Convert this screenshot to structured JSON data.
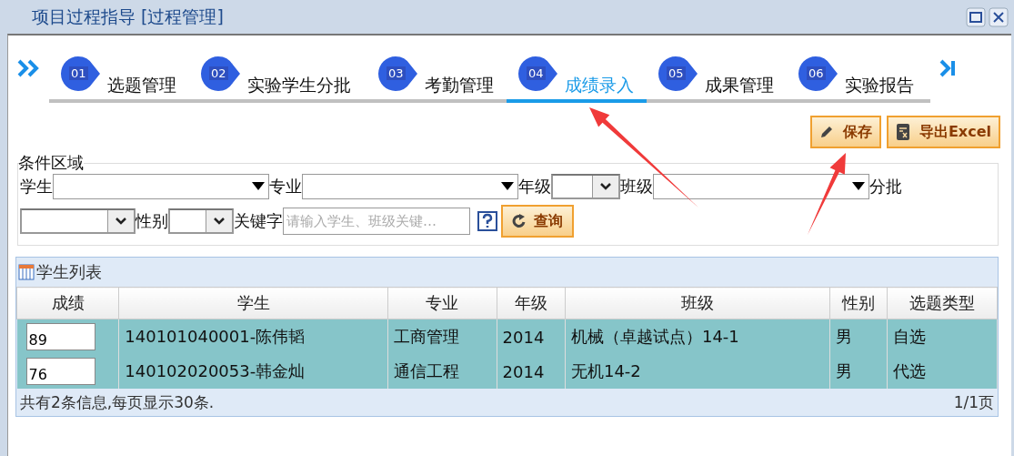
{
  "window": {
    "title": "项目过程指导 [过程管理]"
  },
  "steps": [
    {
      "number": "01",
      "label": "选题管理",
      "selected": false
    },
    {
      "number": "02",
      "label": "实验学生分批",
      "selected": false
    },
    {
      "number": "03",
      "label": "考勤管理",
      "selected": false
    },
    {
      "number": "04",
      "label": "成绩录入",
      "selected": true
    },
    {
      "number": "05",
      "label": "成果管理",
      "selected": false
    },
    {
      "number": "06",
      "label": "实验报告",
      "selected": false
    }
  ],
  "toolbar": [
    {
      "kind": "save",
      "label": "保存"
    },
    {
      "kind": "export",
      "label": "导出Excel"
    }
  ],
  "filters": {
    "legend": "条件区域",
    "fields": [
      {
        "label": "学生",
        "kind": "combo"
      },
      {
        "label": "专业",
        "kind": "combo"
      },
      {
        "label": "年级",
        "kind": "select"
      },
      {
        "label": "班级",
        "kind": "combo"
      },
      {
        "label": "分批",
        "kind": "select"
      },
      {
        "label": "性别",
        "kind": "select"
      },
      {
        "label": "关键字",
        "kind": "text",
        "placeholder": "请输入学生、班级关键…"
      }
    ],
    "search_button": "查询"
  },
  "grid": {
    "title": "学生列表",
    "columns": [
      "成绩",
      "学生",
      "专业",
      "年级",
      "班级",
      "性别",
      "选题类型"
    ],
    "rows": [
      {
        "cells": [
          "89",
          "140101040001-陈伟韬",
          "工商管理",
          "2014",
          "机械（卓越试点）14-1",
          "男",
          "自选"
        ]
      },
      {
        "cells": [
          "76",
          "140102020053-韩金灿",
          "通信工程",
          "2014",
          "无机14-2",
          "男",
          "代选"
        ]
      }
    ],
    "summary": "共有2条信息,每页显示30条.",
    "pages": "1/1页"
  }
}
